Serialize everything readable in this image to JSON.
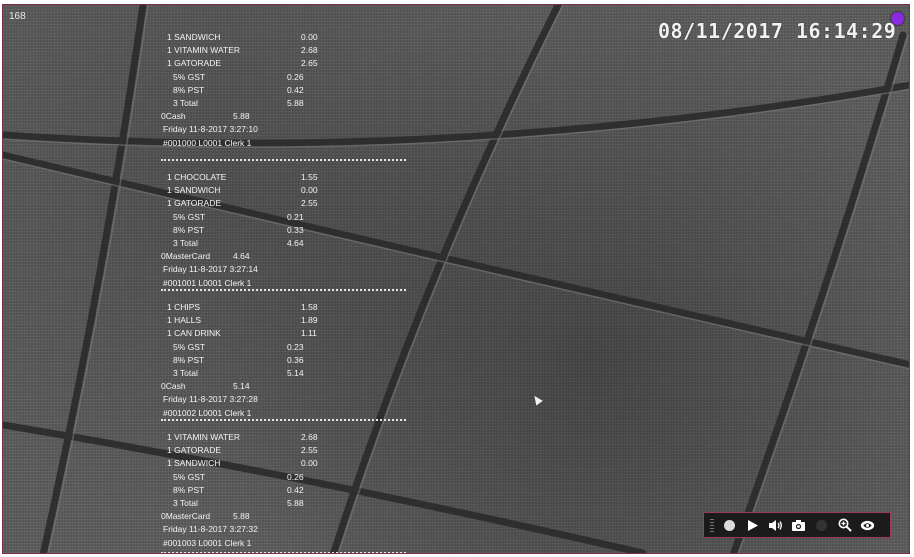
{
  "overlay": {
    "channel": "168",
    "timestamp": "08/11/2017  16:14:29",
    "record_indicator_color": "#8a2be2"
  },
  "receipts": [
    {
      "items": [
        {
          "name": "1 SANDWICH",
          "price": "0.00"
        },
        {
          "name": "1 VITAMIN WATER",
          "price": "2.68"
        },
        {
          "name": "1 GATORADE",
          "price": "2.65"
        }
      ],
      "taxes": [
        {
          "name": "5% GST",
          "amount": "0.26"
        },
        {
          "name": "8% PST",
          "amount": "0.42"
        }
      ],
      "total_label": "3 Total",
      "total": "5.88",
      "payment_label": "0Cash",
      "payment": "5.88",
      "datetime": "Friday    11-8-2017  3:27:10",
      "clerk": "#001000 L0001 Clerk 1"
    },
    {
      "items": [
        {
          "name": "1 CHOCOLATE",
          "price": "1.55"
        },
        {
          "name": "1 SANDWICH",
          "price": "0.00"
        },
        {
          "name": "1 GATORADE",
          "price": "2.55"
        }
      ],
      "taxes": [
        {
          "name": "5% GST",
          "amount": "0.21"
        },
        {
          "name": "8% PST",
          "amount": "0.33"
        }
      ],
      "total_label": "3 Total",
      "total": "4.64",
      "payment_label": "0MasterCard",
      "payment": "4.64",
      "datetime": "Friday    11-8-2017  3:27:14",
      "clerk": "#001001 L0001 Clerk 1"
    },
    {
      "items": [
        {
          "name": "1 CHIPS",
          "price": "1.58"
        },
        {
          "name": "1 HALLS",
          "price": "1.89"
        },
        {
          "name": "1 CAN DRINK",
          "price": "1.11"
        }
      ],
      "taxes": [
        {
          "name": "5% GST",
          "amount": "0.23"
        },
        {
          "name": "8% PST",
          "amount": "0.36"
        }
      ],
      "total_label": "3 Total",
      "total": "5.14",
      "payment_label": "0Cash",
      "payment": "5.14",
      "datetime": "Friday    11-8-2017  3:27:28",
      "clerk": "#001002 L0001 Clerk 1"
    },
    {
      "items": [
        {
          "name": "1 VITAMIN WATER",
          "price": "2.68"
        },
        {
          "name": "1 GATORADE",
          "price": "2.55"
        },
        {
          "name": "1 SANDWICH",
          "price": "0.00"
        }
      ],
      "taxes": [
        {
          "name": "5% GST",
          "amount": "0.26"
        },
        {
          "name": "8% PST",
          "amount": "0.42"
        }
      ],
      "total_label": "3 Total",
      "total": "5.88",
      "payment_label": "0MasterCard",
      "payment": "5.88",
      "datetime": "Friday    11-8-2017  3:27:32",
      "clerk": "#001003 L0001 Clerk 1"
    }
  ],
  "toolbar": {
    "buttons": [
      {
        "name": "record-button",
        "icon": "record-icon"
      },
      {
        "name": "play-button",
        "icon": "play-icon"
      },
      {
        "name": "audio-button",
        "icon": "speaker-icon"
      },
      {
        "name": "snapshot-button",
        "icon": "camera-icon"
      },
      {
        "name": "disabled-button",
        "icon": "circle-icon"
      },
      {
        "name": "zoom-button",
        "icon": "zoom-in-icon"
      },
      {
        "name": "ptz-button",
        "icon": "ptz-icon"
      }
    ]
  }
}
